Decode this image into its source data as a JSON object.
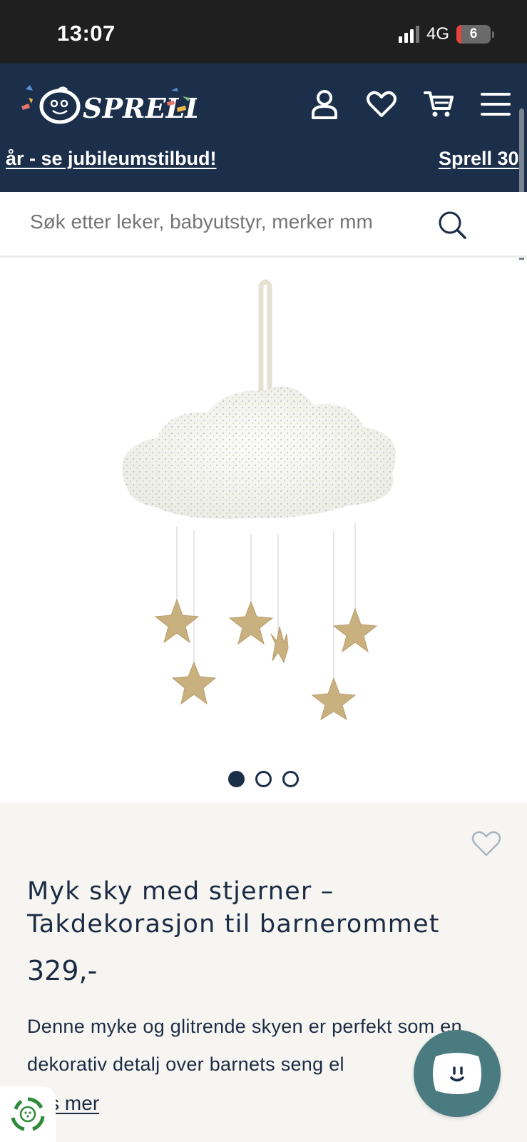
{
  "status_bar": {
    "time": "13:07",
    "network": "4G",
    "battery_level": "6",
    "signal_bars": 3
  },
  "header": {
    "logo_text": "SPRELL",
    "icons": [
      "user-icon",
      "heart-icon",
      "cart-icon",
      "menu-icon"
    ],
    "banner_left": "år - se jubileumstilbud!",
    "banner_right": "Sprell 30"
  },
  "search": {
    "placeholder": "Søk etter leker, babyutstyr, merker mm"
  },
  "gallery": {
    "image_alt": "Myk sky med stjerner",
    "dot_count": 3,
    "active_dot": 0
  },
  "product": {
    "title": "Myk sky med stjerner – Takdekorasjon til barnerommet",
    "price": "329,-",
    "description": "Denne myke og glitrende skyen er perfekt som en dekorativ detalj over barnets seng el",
    "read_more": "Les mer"
  },
  "colors": {
    "navy": "#1b2f4b",
    "teal": "#4a7b80",
    "panel_bg": "#f6f5f1"
  }
}
